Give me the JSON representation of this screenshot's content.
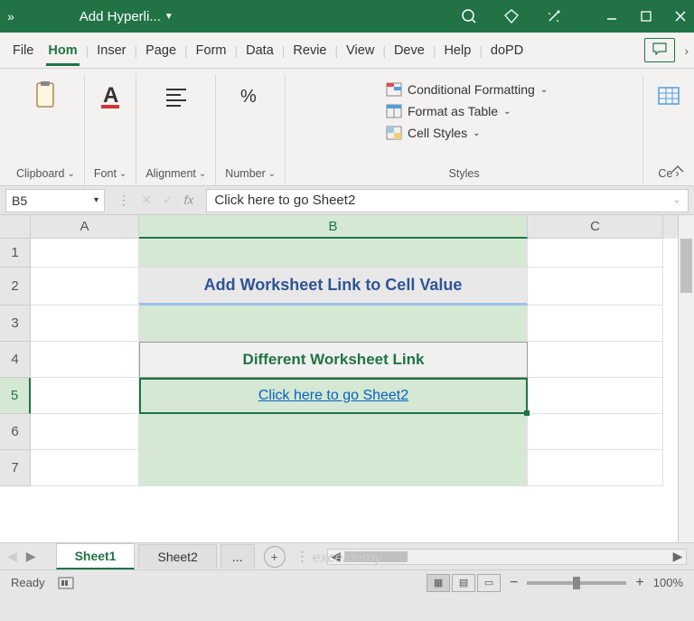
{
  "titlebar": {
    "doc_name": "Add Hyperli..."
  },
  "tabs": {
    "file": "File",
    "home": "Hom",
    "insert": "Inser",
    "page": "Page",
    "form": "Form",
    "data": "Data",
    "review": "Revie",
    "view": "View",
    "dev": "Deve",
    "help": "Help",
    "dopd": "doPD"
  },
  "ribbon": {
    "clipboard": "Clipboard",
    "font": "Font",
    "alignment": "Alignment",
    "number": "Number",
    "styles": "Styles",
    "cells": "Ce",
    "cond_format": "Conditional Formatting",
    "format_table": "Format as Table",
    "cell_styles": "Cell Styles"
  },
  "formula_bar": {
    "name_box": "B5",
    "fx": "fx",
    "value": "Click here to go Sheet2"
  },
  "columns": {
    "a": "A",
    "b": "B",
    "c": "C"
  },
  "rows": {
    "r1": "1",
    "r2": "2",
    "r3": "3",
    "r4": "4",
    "r5": "5",
    "r6": "6",
    "r7": "7"
  },
  "cells": {
    "b2": "Add Worksheet Link to Cell Value",
    "b4": "Different Worksheet Link",
    "b5": "Click here to go Sheet2"
  },
  "sheets": {
    "s1": "Sheet1",
    "s2": "Sheet2",
    "more": "..."
  },
  "statusbar": {
    "ready": "Ready",
    "zoom": "100%"
  },
  "watermark": "exceldemy"
}
